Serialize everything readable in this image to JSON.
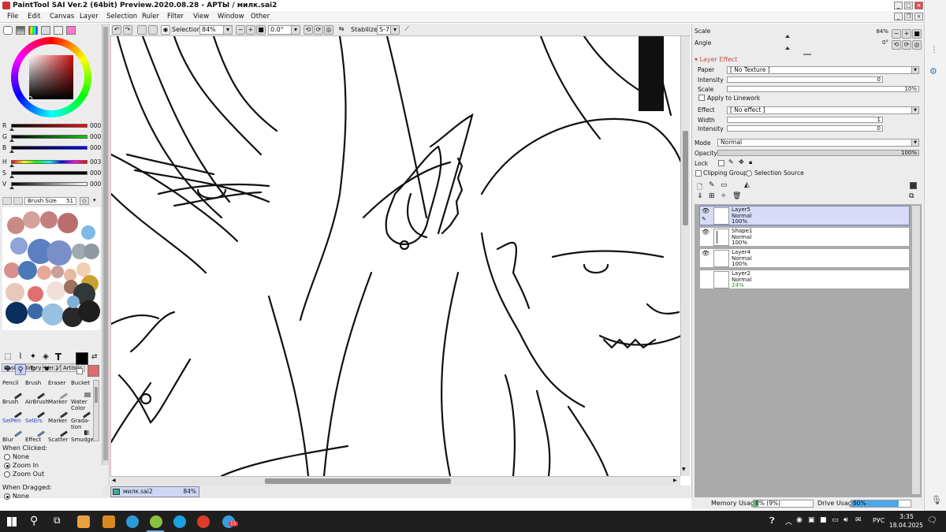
{
  "window": {
    "title": "PaintTool SAI Ver.2 (64bit) Preview.2020.08.28 - АРТЫ / милк.sai2",
    "controls": {
      "minimize": "_",
      "maximize": "□",
      "close": "×"
    }
  },
  "menu": [
    "File",
    "Edit",
    "Canvas",
    "Layer",
    "Selection",
    "Ruler",
    "Filter",
    "View",
    "Window",
    "Other"
  ],
  "toolbar": {
    "selection_label": "Selection",
    "zoom": "84%",
    "rotation": "0.0°",
    "stabilizer_label": "Stabilizer",
    "stabilizer_value": "S-7"
  },
  "color": {
    "sliders": [
      {
        "label": "R",
        "value": "000"
      },
      {
        "label": "G",
        "value": "000"
      },
      {
        "label": "B",
        "value": "000"
      },
      {
        "label": "H",
        "value": "003"
      },
      {
        "label": "S",
        "value": "000"
      },
      {
        "label": "V",
        "value": "000"
      }
    ],
    "primary": "#000000",
    "secondary": "#e06a6a"
  },
  "brush_size": {
    "label": "Brush Size",
    "value": "51"
  },
  "tool_tabs": [
    "Basic",
    "Binary",
    "Ver.1",
    "Artistic"
  ],
  "tools": [
    [
      "Pencil",
      "Brush",
      "Eraser",
      "Bucket"
    ],
    [
      "Brush",
      "AirBrush",
      "Marker",
      "Water Color"
    ],
    [
      "SelPen",
      "SelErs",
      "Marker",
      "Grada-tion"
    ],
    [
      "Blur",
      "Effect",
      "Scatter",
      "Smudge"
    ]
  ],
  "when_clicked": {
    "label": "When Clicked:",
    "options": [
      "None",
      "Zoom In",
      "Zoom Out"
    ],
    "selected": "Zoom In"
  },
  "when_dragged": {
    "label": "When Dragged:",
    "options": [
      "None"
    ],
    "selected": "None"
  },
  "document_tab": {
    "name": "милк.sai2",
    "zoom": "84%"
  },
  "navigator": {
    "scale_label": "Scale",
    "scale_value": "84%",
    "angle_label": "Angle",
    "angle_value": "0°"
  },
  "layer_effect": {
    "header": "Layer Effect",
    "paper_label": "Paper",
    "paper_value": "[ No Texture ]",
    "intensity_label": "Intensity",
    "intensity_value": "0",
    "scale_label": "Scale",
    "scale_value": "10%",
    "apply_linework": "Apply to Linework",
    "effect_label": "Effect",
    "effect_value": "[ No effect ]",
    "width_label": "Width",
    "width_value": "1",
    "intensity2_label": "Intensity",
    "intensity2_value": "0"
  },
  "layer_props": {
    "mode_label": "Mode",
    "mode_value": "Normal",
    "opacity_label": "Opacity",
    "opacity_value": "100%",
    "lock_label": "Lock",
    "clipping_label": "Clipping Group",
    "selection_source_label": "Selection Source"
  },
  "layers": [
    {
      "name": "Layer5",
      "mode": "Normal",
      "opacity": "100%",
      "visible": true,
      "selected": true
    },
    {
      "name": "Shape1",
      "mode": "Normal",
      "opacity": "100%",
      "visible": true,
      "selected": false
    },
    {
      "name": "Layer4",
      "mode": "Normal",
      "opacity": "100%",
      "visible": true,
      "selected": false
    },
    {
      "name": "Layer2",
      "mode": "Normal",
      "opacity": "24%",
      "visible": false,
      "selected": false
    }
  ],
  "status": {
    "memory_label": "Memory Usage",
    "memory_value": "8% (9%)",
    "memory_fraction": 0.08,
    "drive_label": "Drive Usage",
    "drive_value": "80%",
    "drive_fraction": 0.8
  },
  "taskbar": {
    "language": "РУС",
    "time": "3:35",
    "date": "18.04.2025",
    "tray_badge": "15"
  },
  "colors": {
    "accent": "#c0504d",
    "selected_layer": "#d8dbf8",
    "drive_bar": "#4aa8e8",
    "memory_bar": "#5bc86e"
  }
}
